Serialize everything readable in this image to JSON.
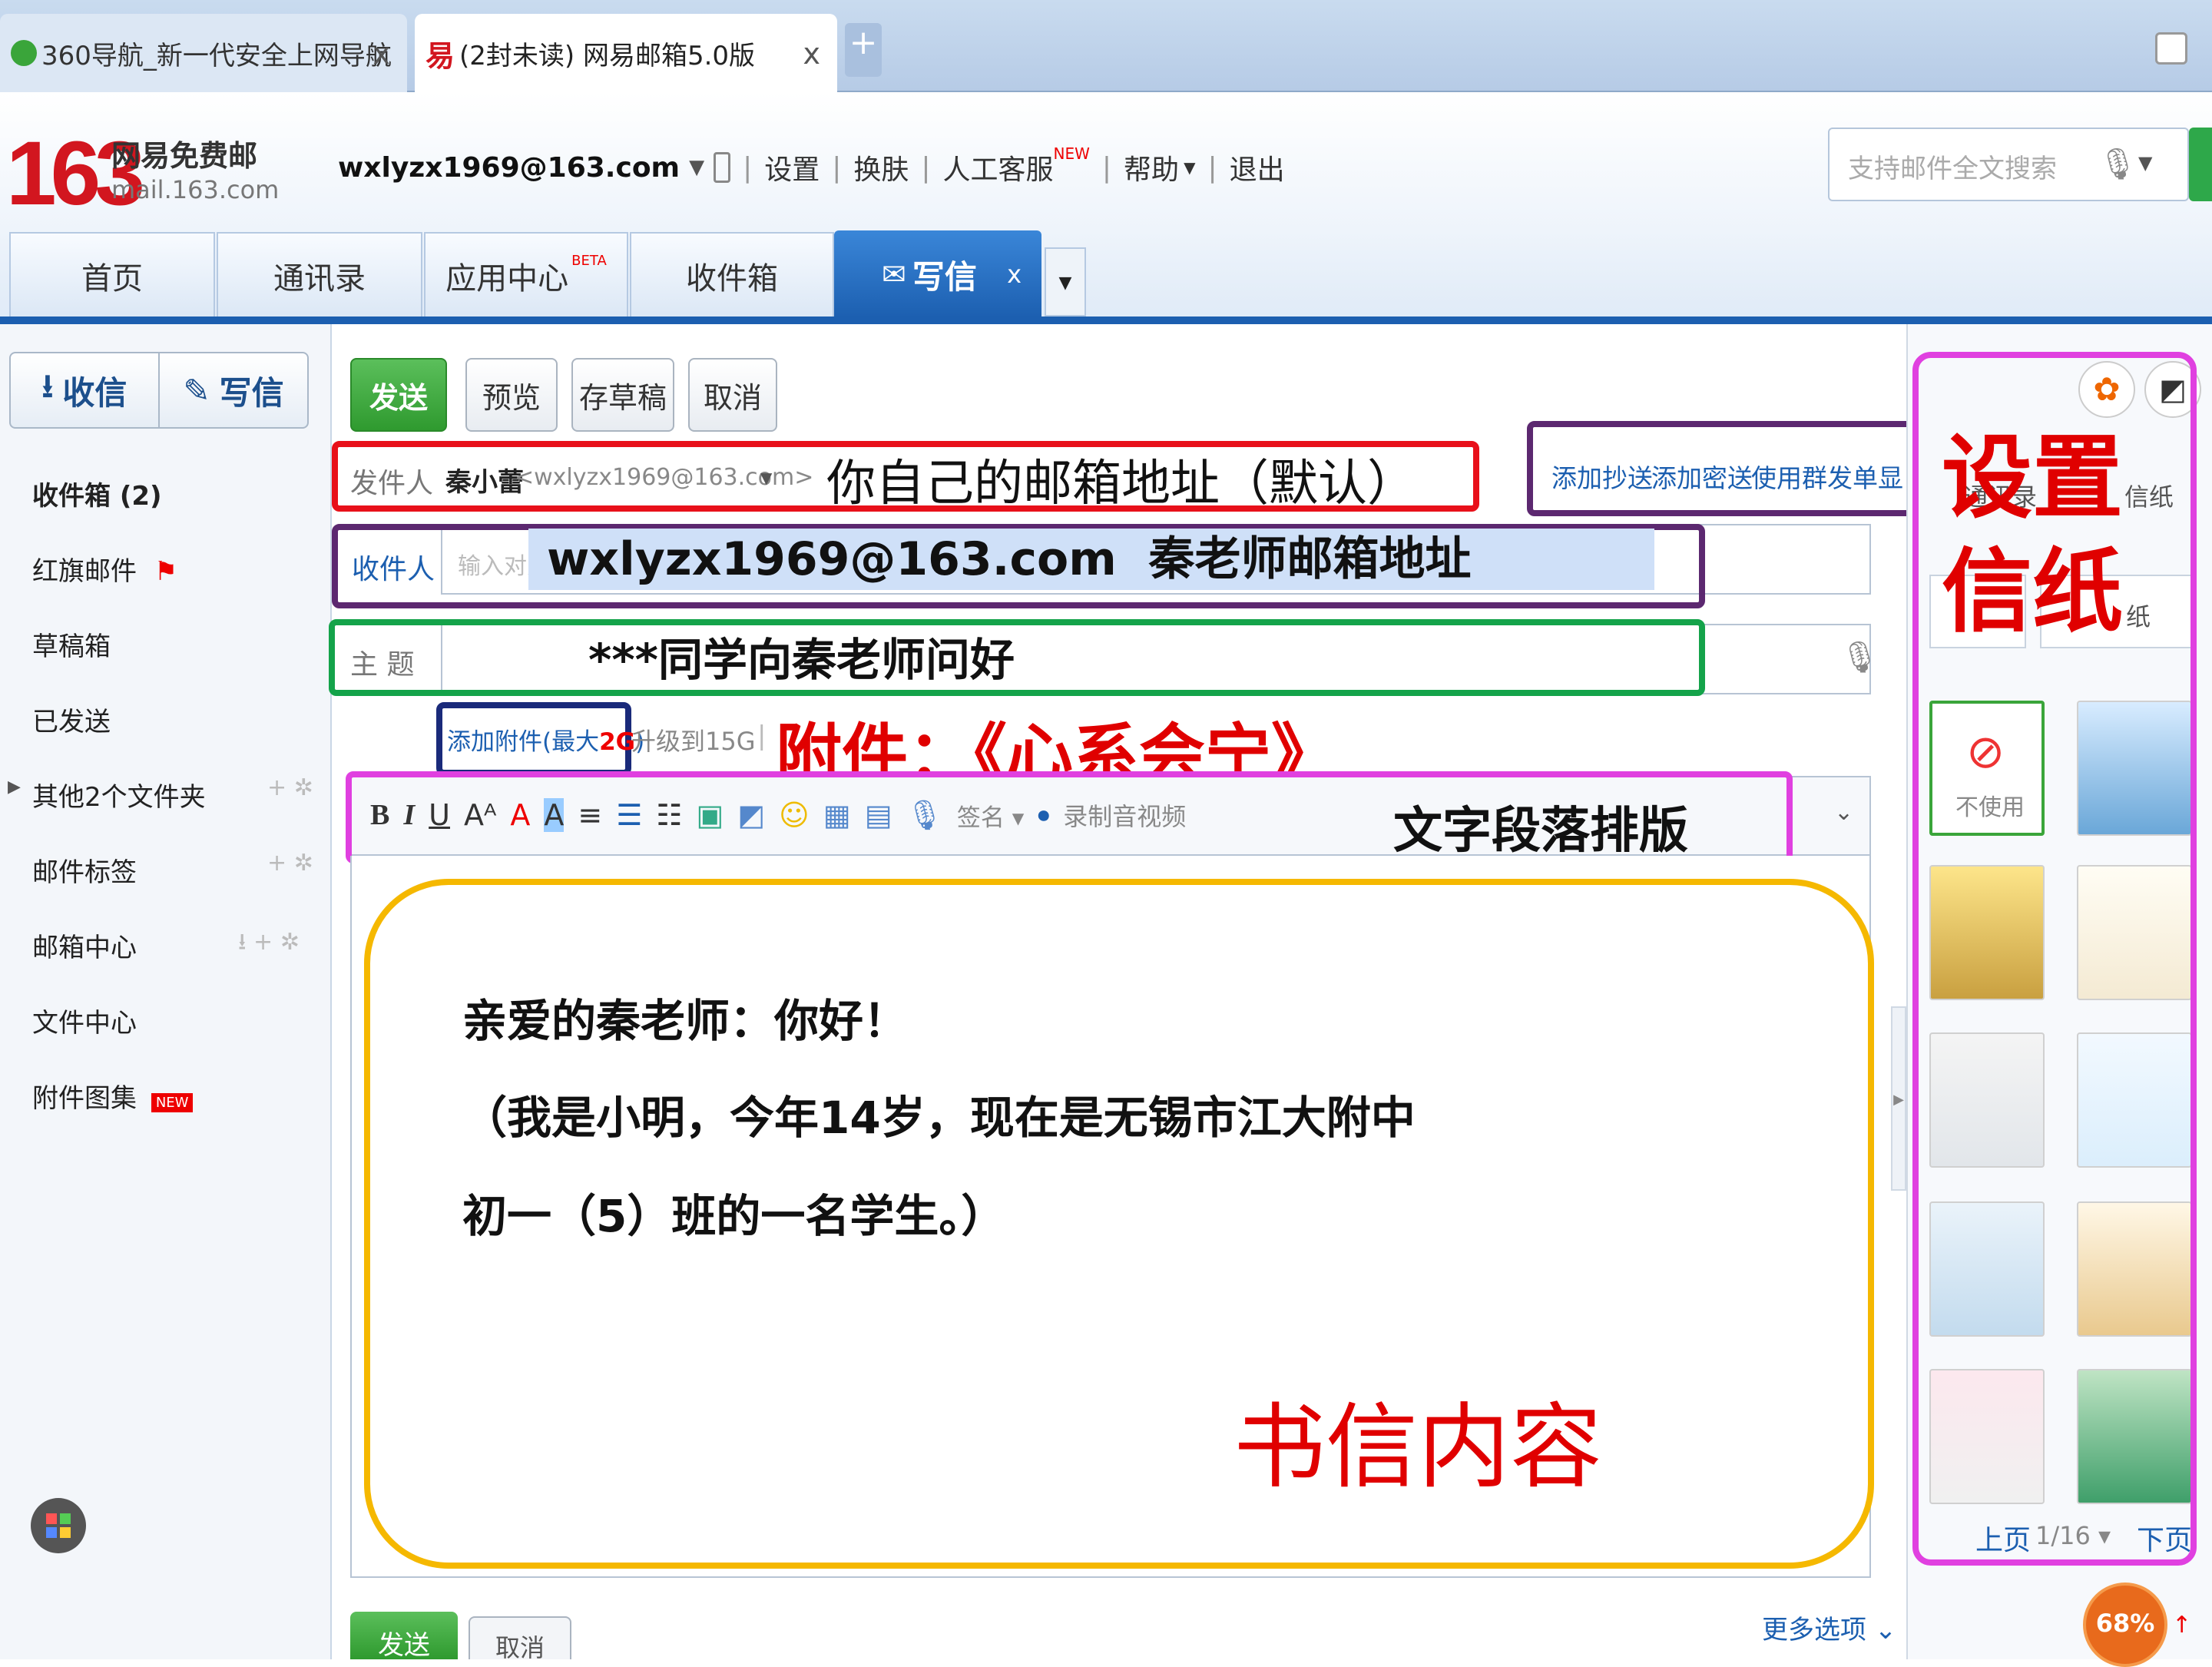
{
  "browser": {
    "tabs": [
      {
        "label": "360导航_新一代安全上网导航",
        "close": "x"
      },
      {
        "label": "(2封未读) 网易邮箱5.0版",
        "close": "x"
      }
    ],
    "new_tab": "+"
  },
  "header": {
    "logo_number": "163",
    "logo_title": "网易免费邮",
    "logo_domain": "mail.163.com",
    "account": "wxlyzx1969@163.com",
    "links": [
      "设置",
      "换肤",
      "人工客服",
      "帮助",
      "退出"
    ],
    "new_badge": "NEW",
    "search_placeholder": "支持邮件全文搜索"
  },
  "nav": {
    "tabs": [
      "首页",
      "通讯录",
      "应用中心",
      "收件箱"
    ],
    "beta": "BETA",
    "active_tab": "写信",
    "active_close": "x"
  },
  "sidebar": {
    "receive": "收信",
    "compose": "写信",
    "items": [
      "收件箱 (2)",
      "红旗邮件",
      "草稿箱",
      "已发送",
      "其他2个文件夹",
      "邮件标签",
      "邮箱中心",
      "文件中心",
      "附件图集"
    ],
    "new_badge": "NEW"
  },
  "toolbar": {
    "send": "发送",
    "preview": "预览",
    "draft": "存草稿",
    "cancel": "取消"
  },
  "compose": {
    "sender_label": "发件人",
    "sender_name": "秦小蕾",
    "sender_addr": "<wxlyzx1969@163.com>",
    "sender_note": "你自己的邮箱地址（默认）",
    "cc_links": [
      "添加抄送",
      "添加密送",
      "使用群发单显"
    ],
    "to_label": "收件人",
    "to_placeholder": "输入对方",
    "to_value": "wxlyzx1969@163.com  秦老师邮箱地址",
    "subject_label": "主 题",
    "subject_value": "***同学向秦老师问好",
    "attach_link": "添加附件(最大",
    "attach_size": "2G",
    "attach_close": ")",
    "upgrade": "升级到15G",
    "attach_note": "附件：《心系会宁》",
    "format_note": "文字段落排版",
    "signature": "签名",
    "record": "录制音视频",
    "body_lines": [
      "亲爱的秦老师：你好！",
      "（我是小明，今年14岁，现在是无锡市江大附中",
      "初一（5）班的一名学生。）"
    ],
    "body_note": "书信内容",
    "more_options": "更多选项",
    "bottom_send": "发送",
    "bottom_cancel": "取消"
  },
  "rightpanel": {
    "annotation": "设置信纸",
    "tab_labels": [
      "通讯录",
      "信纸"
    ],
    "no_use": "不使用",
    "pager_prev": "上页",
    "pager_count": "1/16",
    "pager_next": "下页",
    "progress": "68%"
  },
  "colors": {
    "red_box": "#e8101a",
    "purple_box": "#5c2870",
    "green_box": "#14a34a",
    "navy_box": "#1a2a7a",
    "magenta_box": "#e040e0",
    "orange_box": "#f5b800",
    "annotation_red": "#e00000",
    "brand_red": "#d2161f",
    "nav_blue": "#1c5fb0"
  }
}
